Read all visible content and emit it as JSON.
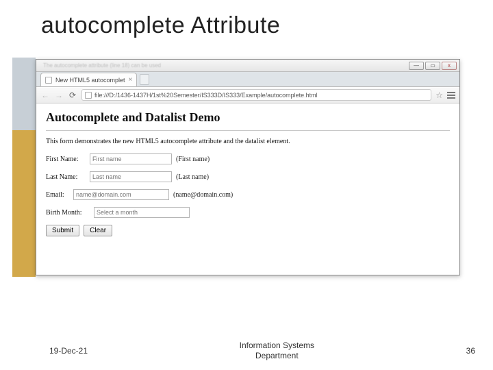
{
  "slide": {
    "title": "autocomplete Attribute",
    "date": "19-Dec-21",
    "org_line1": "Information Systems",
    "org_line2": "Department",
    "page_number": "36"
  },
  "window": {
    "titlebar_background_text": "The autocomplete attribute (line 18) can be used",
    "btn_min": "—",
    "btn_max": "▭",
    "btn_close": "x"
  },
  "tab": {
    "title": "New HTML5 autocomplet",
    "close": "×"
  },
  "toolbar": {
    "back": "←",
    "forward": "→",
    "reload": "⟳",
    "url": "file:///D:/1436-1437H/1st%20Semester/IS333D/IS333/Example/autocomplete.html",
    "star": "☆"
  },
  "page": {
    "heading": "Autocomplete and Datalist Demo",
    "description": "This form demonstrates the new HTML5 autocomplete attribute and the datalist element.",
    "firstname_label": "First Name:",
    "firstname_ph": "First name",
    "firstname_hint": "(First name)",
    "lastname_label": "Last Name:",
    "lastname_ph": "Last name",
    "lastname_hint": "(Last name)",
    "email_label": "Email:",
    "email_ph": "name@domain.com",
    "email_hint": "(name@domain.com)",
    "birth_label": "Birth Month:",
    "birth_ph": "Select a month",
    "submit": "Submit",
    "clear": "Clear"
  }
}
